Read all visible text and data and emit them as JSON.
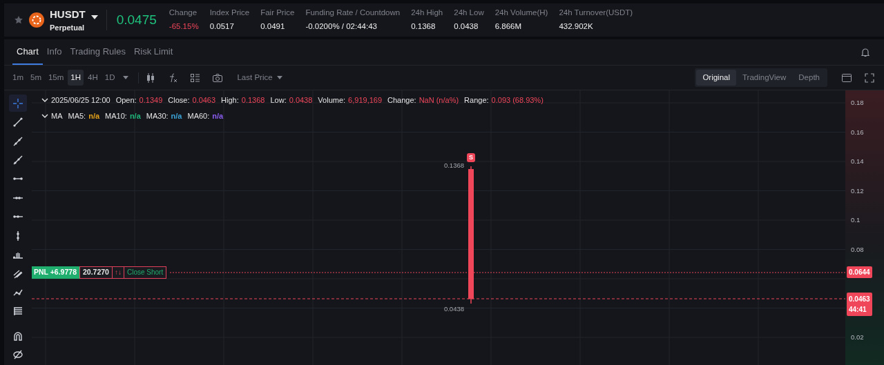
{
  "header": {
    "favorite": false,
    "symbol": "HUSDT",
    "subtitle": "Perpetual",
    "last_price": "0.0475",
    "stats": [
      {
        "label": "Change",
        "value": "-65.15%",
        "kind": "change"
      },
      {
        "label": "Index Price",
        "value": "0.0517",
        "kind": "plain"
      },
      {
        "label": "Fair Price",
        "value": "0.0491",
        "kind": "plain"
      },
      {
        "label": "Funding Rate / Countdown",
        "value": "-0.0200% / 02:44:43",
        "kind": "plain"
      },
      {
        "label": "24h High",
        "value": "0.1368",
        "kind": "plain"
      },
      {
        "label": "24h Low",
        "value": "0.0438",
        "kind": "plain"
      },
      {
        "label": "24h Volume(H)",
        "value": "6.866M",
        "kind": "plain"
      },
      {
        "label": "24h Turnover(USDT)",
        "value": "432.902K",
        "kind": "plain"
      }
    ]
  },
  "tabs": [
    {
      "label": "Chart",
      "selected": true
    },
    {
      "label": "Info",
      "selected": false
    },
    {
      "label": "Trading Rules",
      "selected": false
    },
    {
      "label": "Risk Limit",
      "selected": false
    }
  ],
  "toolbar": {
    "intervals": [
      {
        "label": "1m",
        "selected": false
      },
      {
        "label": "5m",
        "selected": false
      },
      {
        "label": "15m",
        "selected": false
      },
      {
        "label": "1H",
        "selected": true
      },
      {
        "label": "4H",
        "selected": false
      },
      {
        "label": "1D",
        "selected": false
      }
    ],
    "price_type": "Last Price",
    "views": [
      {
        "label": "Original",
        "selected": true
      },
      {
        "label": "TradingView",
        "selected": false
      },
      {
        "label": "Depth",
        "selected": false
      }
    ]
  },
  "legend": {
    "datetime": "2025/06/25 12:00",
    "fields": [
      {
        "label": "Open:",
        "value": "0.1349"
      },
      {
        "label": "Close:",
        "value": "0.0463"
      },
      {
        "label": "High:",
        "value": "0.1368"
      },
      {
        "label": "Low:",
        "value": "0.0438"
      },
      {
        "label": "Volume:",
        "value": "6,919,169"
      },
      {
        "label": "Change:",
        "value": "NaN (n/a%)"
      },
      {
        "label": "Range:",
        "value": "0.093 (68.93%)"
      }
    ],
    "ma_label": "MA",
    "ma": [
      {
        "label": "MA5:",
        "value": "n/a",
        "color": "#e3a21a"
      },
      {
        "label": "MA10:",
        "value": "n/a",
        "color": "#1fb57a"
      },
      {
        "label": "MA30:",
        "value": "n/a",
        "color": "#3ba3d6"
      },
      {
        "label": "MA60:",
        "value": "n/a",
        "color": "#8a5cf0"
      }
    ]
  },
  "chart": {
    "yticks": [
      "0.18",
      "0.16",
      "0.14",
      "0.12",
      "0.1",
      "0.08",
      "0.02"
    ],
    "high_label": "0.1368",
    "low_label": "0.0438",
    "signal": "S",
    "position": {
      "pnl": "PNL +6.9778",
      "size": "20.7270",
      "arrows": "↑↓",
      "action": "Close Short",
      "price": "0.0644"
    },
    "last": {
      "price": "0.0463",
      "countdown": "44:41"
    }
  }
}
